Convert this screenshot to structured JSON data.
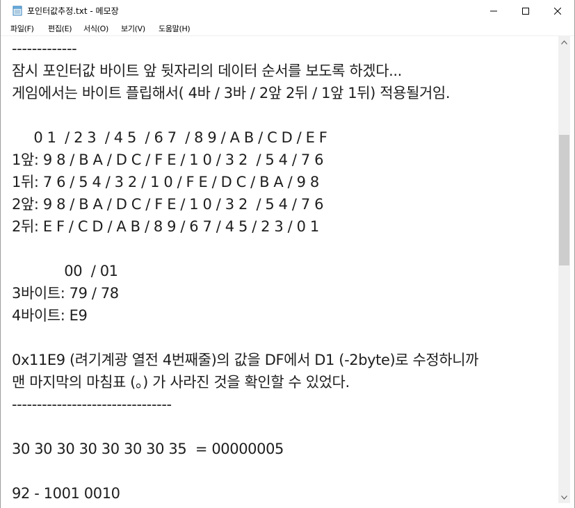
{
  "window": {
    "title": "포인터값추정.txt - 메모장"
  },
  "menu": {
    "file": "파일(F)",
    "edit": "편집(E)",
    "format": "서식(O)",
    "view": "보기(V)",
    "help": "도움말(H)"
  },
  "editor": {
    "lines": [
      "-------------",
      "잠시 포인터값 바이트 앞 뒷자리의 데이터 순서를 보도록 하겠다...",
      "게임에서는 바이트 플립해서( 4바 / 3바 / 2앞 2뒤 / 1앞 1뒤) 적용될거임.",
      "",
      "     0 1  / 2 3  / 4 5  / 6 7  / 8 9 / A B / C D / E F",
      "1앞: 9 8 / B A / D C / F E / 1 0 / 3 2  / 5 4 / 7 6",
      "1뒤: 7 6 / 5 4 / 3 2 / 1 0 / F E / D C / B A / 9 8",
      "2앞: 9 8 / B A / D C / F E / 1 0 / 3 2  / 5 4 / 7 6",
      "2뒤: E F / C D / A B / 8 9 / 6 7 / 4 5 / 2 3 / 0 1",
      "",
      "            00  / 01",
      "3바이트: 79 / 78",
      "4바이트: E9",
      "",
      "0x11E9 (려기계광 열전 4번째줄)의 값을 DF에서 D1 (-2byte)로 수정하니까",
      "맨 마지막의 마침표 (。) 가 사라진 것을 확인할 수 있었다.",
      "--------------------------------",
      "",
      "30 30 30 30 30 30 30 35  = 00000005",
      "",
      "92 - 1001 0010"
    ]
  },
  "colors": {
    "text": "#1e1e1e",
    "scrollbar_track": "#f0f0f0",
    "scrollbar_thumb": "#cdcdcd"
  }
}
